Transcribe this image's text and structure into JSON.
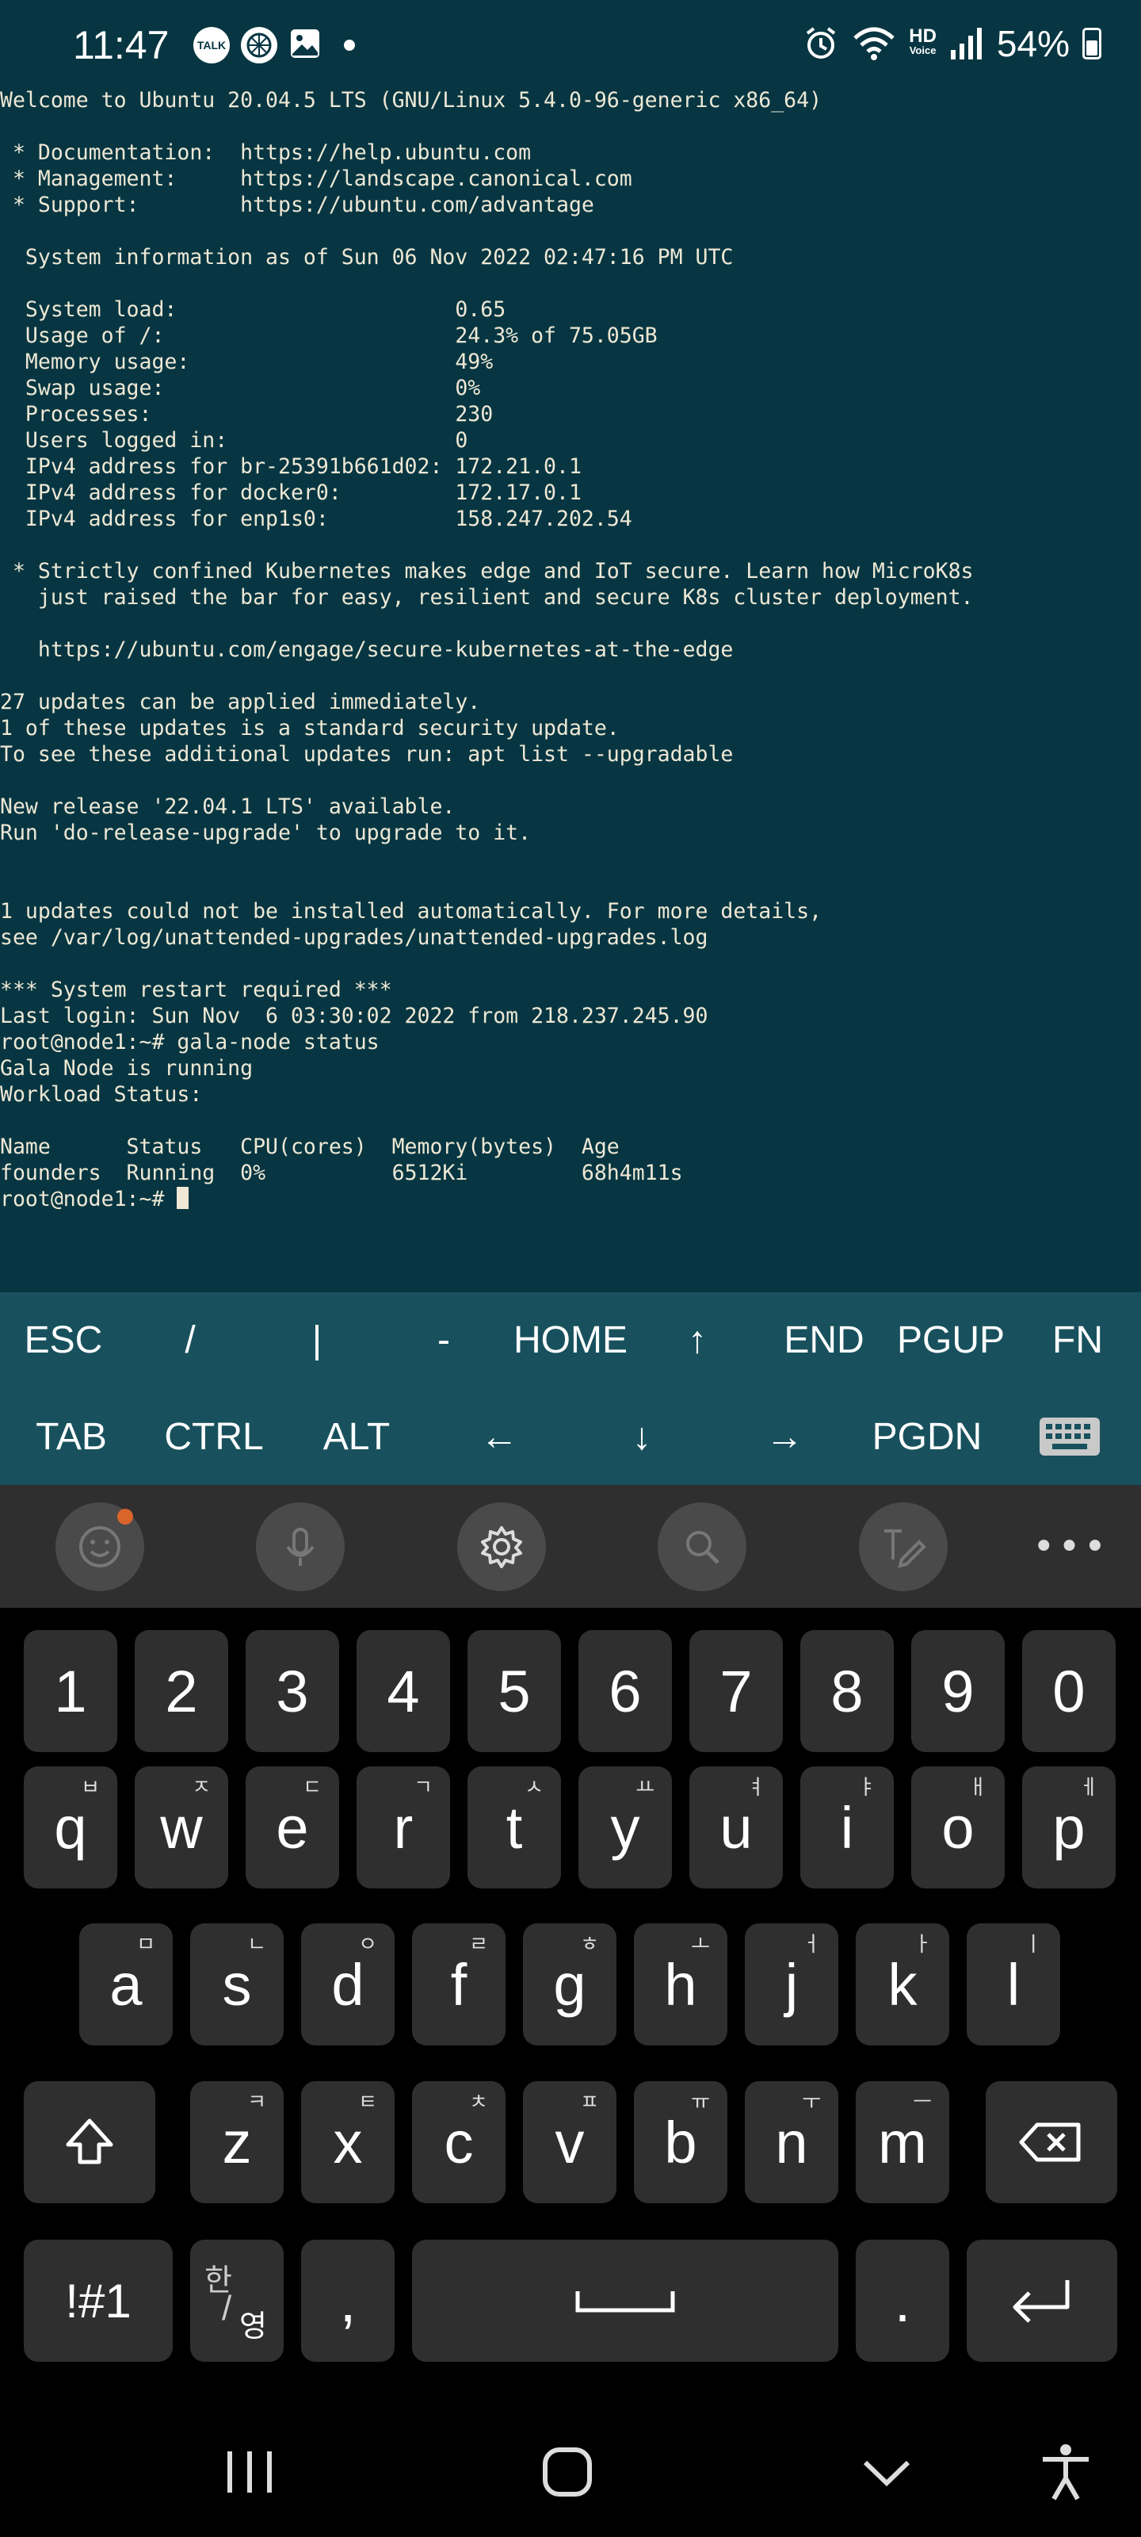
{
  "status_bar": {
    "time": "11:47",
    "left_icons": [
      "talk-icon",
      "pinwheel-icon",
      "gallery-icon",
      "dot-icon"
    ],
    "talk_label": "TALK",
    "hd_label": "HD",
    "voice_label": "Voice",
    "battery": "54%",
    "right_icons": [
      "alarm-icon",
      "wifi-icon",
      "hd-voice-icon",
      "signal-icon",
      "battery-icon"
    ]
  },
  "terminal": {
    "lines": [
      "Welcome to Ubuntu 20.04.5 LTS (GNU/Linux 5.4.0-96-generic x86_64)",
      "",
      " * Documentation:  https://help.ubuntu.com",
      " * Management:     https://landscape.canonical.com",
      " * Support:        https://ubuntu.com/advantage",
      "",
      "  System information as of Sun 06 Nov 2022 02:47:16 PM UTC",
      "",
      "  System load:                      0.65",
      "  Usage of /:                       24.3% of 75.05GB",
      "  Memory usage:                     49%",
      "  Swap usage:                       0%",
      "  Processes:                        230",
      "  Users logged in:                  0",
      "  IPv4 address for br-25391b661d02: 172.21.0.1",
      "  IPv4 address for docker0:         172.17.0.1",
      "  IPv4 address for enp1s0:          158.247.202.54",
      "",
      " * Strictly confined Kubernetes makes edge and IoT secure. Learn how MicroK8s",
      "   just raised the bar for easy, resilient and secure K8s cluster deployment.",
      "",
      "   https://ubuntu.com/engage/secure-kubernetes-at-the-edge",
      "",
      "27 updates can be applied immediately.",
      "1 of these updates is a standard security update.",
      "To see these additional updates run: apt list --upgradable",
      "",
      "New release '22.04.1 LTS' available.",
      "Run 'do-release-upgrade' to upgrade to it.",
      "",
      "",
      "1 updates could not be installed automatically. For more details,",
      "see /var/log/unattended-upgrades/unattended-upgrades.log",
      "",
      "*** System restart required ***",
      "Last login: Sun Nov  6 03:30:02 2022 from 218.237.245.90",
      "root@node1:~# gala-node status",
      "Gala Node is running",
      "Workload Status:",
      "",
      "Name      Status   CPU(cores)  Memory(bytes)  Age",
      "founders  Running  0%          6512Ki         68h4m11s"
    ],
    "prompt": "root@node1:~# "
  },
  "extra_keys": {
    "row1": [
      "ESC",
      "/",
      "|",
      "-",
      "HOME",
      "↑",
      "END",
      "PGUP",
      "FN"
    ],
    "row2": [
      "TAB",
      "CTRL",
      "ALT",
      "←",
      "↓",
      "→",
      "PGDN",
      "keyboard-icon"
    ]
  },
  "keyboard": {
    "toolbar": [
      "emoji-icon",
      "mic-icon",
      "settings-icon",
      "search-icon",
      "handwriting-icon",
      "more-icon"
    ],
    "toolbar_more": "•••",
    "numbers": [
      "1",
      "2",
      "3",
      "4",
      "5",
      "6",
      "7",
      "8",
      "9",
      "0"
    ],
    "row1": [
      {
        "k": "q",
        "s": "ㅂ"
      },
      {
        "k": "w",
        "s": "ㅈ"
      },
      {
        "k": "e",
        "s": "ㄷ"
      },
      {
        "k": "r",
        "s": "ㄱ"
      },
      {
        "k": "t",
        "s": "ㅅ"
      },
      {
        "k": "y",
        "s": "ㅛ"
      },
      {
        "k": "u",
        "s": "ㅕ"
      },
      {
        "k": "i",
        "s": "ㅑ"
      },
      {
        "k": "o",
        "s": "ㅐ"
      },
      {
        "k": "p",
        "s": "ㅔ"
      }
    ],
    "row2": [
      {
        "k": "a",
        "s": "ㅁ"
      },
      {
        "k": "s",
        "s": "ㄴ"
      },
      {
        "k": "d",
        "s": "ㅇ"
      },
      {
        "k": "f",
        "s": "ㄹ"
      },
      {
        "k": "g",
        "s": "ㅎ"
      },
      {
        "k": "h",
        "s": "ㅗ"
      },
      {
        "k": "j",
        "s": "ㅓ"
      },
      {
        "k": "k",
        "s": "ㅏ"
      },
      {
        "k": "l",
        "s": "ㅣ"
      }
    ],
    "row3": [
      {
        "k": "z",
        "s": "ㅋ"
      },
      {
        "k": "x",
        "s": "ㅌ"
      },
      {
        "k": "c",
        "s": "ㅊ"
      },
      {
        "k": "v",
        "s": "ㅍ"
      },
      {
        "k": "b",
        "s": "ㅠ"
      },
      {
        "k": "n",
        "s": "ㅜ"
      },
      {
        "k": "m",
        "s": "ㅡ"
      }
    ],
    "symbols": "!#1",
    "lang_top": "한",
    "lang_bottom": "영",
    "comma": ",",
    "period": "."
  },
  "nav_bar": [
    "recents-icon",
    "home-icon",
    "hide-keyboard-icon",
    "accessibility-icon"
  ]
}
